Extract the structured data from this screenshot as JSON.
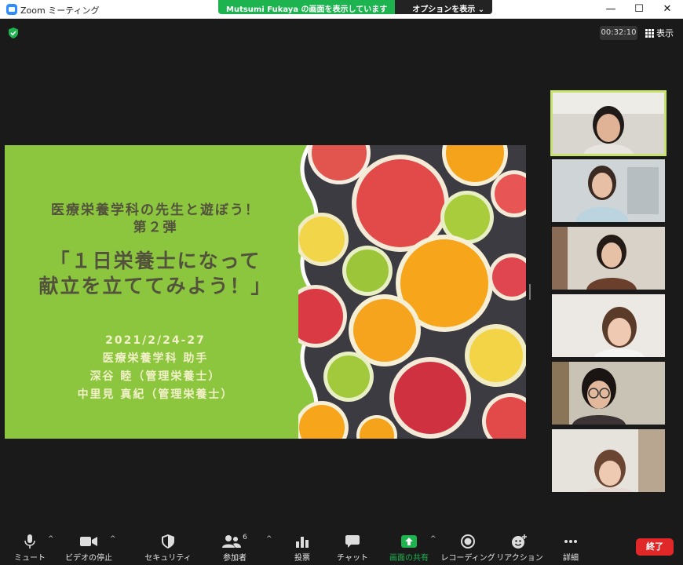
{
  "window": {
    "title": "Zoom ミーティング",
    "minimize": "—",
    "maximize": "☐",
    "close": "✕"
  },
  "share_banner": {
    "message": "Mutsumi  Fukaya の画面を表示しています",
    "options": "オプションを表示 ⌄"
  },
  "status": {
    "timer": "00:32:10",
    "view_label": "表示"
  },
  "slide": {
    "heading_line1": "医療栄養学科の先生と遊ぼう！",
    "heading_line2": "第２弾",
    "main_line1": "「１日栄養士になって",
    "main_line2": "献立を立ててみよう！」",
    "date": "2021/2/24-27",
    "dept": "医療栄養学科 助手",
    "person1": "深谷 睦（管理栄養士）",
    "person2": "中里見 真紀（管理栄養士）"
  },
  "toolbar": {
    "mute": "ミュート",
    "stop_video": "ビデオの停止",
    "security": "セキュリティ",
    "participants": "参加者",
    "participant_count": "6",
    "polls": "投票",
    "chat": "チャット",
    "share_screen": "画面の共有",
    "record": "レコーディング",
    "reactions": "リアクション",
    "more": "詳細",
    "end": "終了",
    "caret": "^"
  },
  "colors": {
    "slide_green": "#8cc63f",
    "share_green": "#1db450",
    "end_red": "#e02828",
    "active_speaker": "#c7e36b"
  }
}
